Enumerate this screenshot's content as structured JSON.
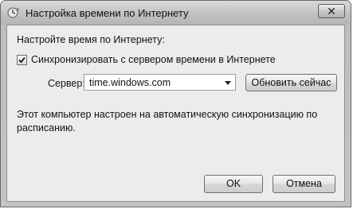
{
  "window": {
    "title": "Настройка времени по Интернету",
    "close_label": "✕"
  },
  "content": {
    "heading": "Настройте время по Интернету:",
    "sync_checkbox": {
      "label": "Синхронизировать с сервером времени в Интернете",
      "checked": true
    },
    "server": {
      "label": "Сервер:",
      "value": "time.windows.com"
    },
    "update_button": "Обновить сейчас",
    "info_text": "Этот компьютер настроен на автоматическую синхронизацию по расписанию."
  },
  "buttons": {
    "ok": "OK",
    "cancel": "Отмена"
  }
}
